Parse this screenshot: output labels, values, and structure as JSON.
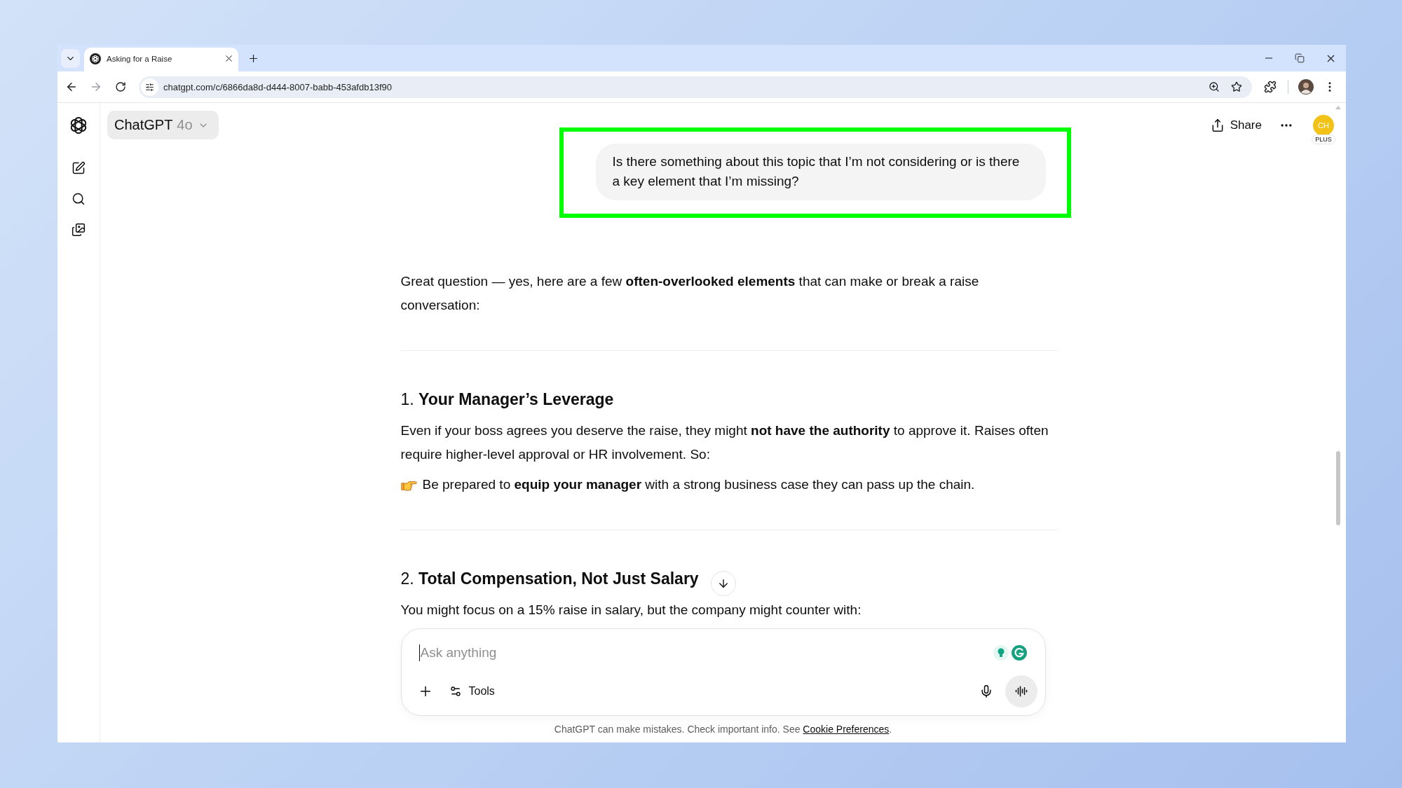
{
  "browser": {
    "tabs": [
      {
        "title": "Asking for a Raise",
        "selected": true
      }
    ],
    "url": "chatgpt.com/c/6866da8d-d444-8007-babb-453afdb13f90"
  },
  "header": {
    "model": {
      "name": "ChatGPT",
      "version": "4o"
    },
    "share": "Share",
    "avatar": {
      "initials": "CH",
      "badge": "PLUS"
    }
  },
  "conversation": {
    "user_message": {
      "text": "Is there something about this topic that I’m not considering or is there a key element that I’m missing?",
      "highlighted": true
    },
    "reply": [
      {
        "kind": "paragraph",
        "text": "Great question — yes, here are a few **often-overlooked elements** that can make or break a raise conversation:"
      },
      {
        "kind": "divider"
      },
      {
        "kind": "heading",
        "text": "1. **Your Manager’s Leverage**"
      },
      {
        "kind": "paragraph",
        "text": "Even if your boss agrees you deserve the raise, they might **not have the authority** to approve it. Raises often require higher-level approval or HR involvement. So:"
      },
      {
        "kind": "pointer",
        "text": "Be prepared to **equip your manager** with a strong business case they can pass up the chain."
      },
      {
        "kind": "divider"
      },
      {
        "kind": "heading",
        "text": "2. **Total Compensation, Not Just Salary**"
      },
      {
        "kind": "paragraph",
        "text": "You might focus on a 15% raise in salary, but the company might counter with:"
      }
    ]
  },
  "composer": {
    "placeholder": "Ask anything",
    "tools": "Tools"
  },
  "footer": {
    "text": "ChatGPT can make mistakes. Check important info. See",
    "link": "Cookie Preferences",
    "end": "."
  }
}
